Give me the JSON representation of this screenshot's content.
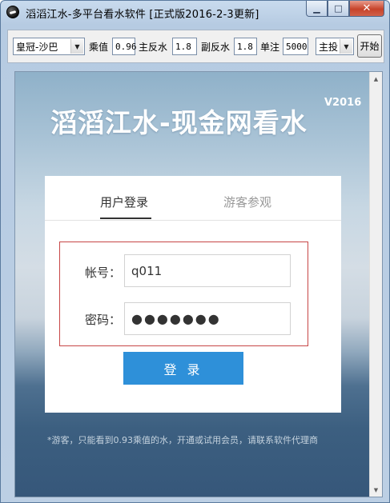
{
  "window": {
    "title": "滔滔江水-多平台看水软件  [正式版2016-2-3更新]",
    "controls": {
      "minimize": "▁",
      "maximize": "□",
      "close": "✕"
    }
  },
  "toolbar": {
    "site_select": "皇冠-沙巴",
    "odds_label": "乘值",
    "odds_value": "0.96",
    "main_rebate_label": "主反水",
    "main_rebate_value": "1.8",
    "sub_rebate_label": "副反水",
    "sub_rebate_value": "1.8",
    "single_bet_label": "单注",
    "single_bet_value": "5000",
    "mode_select": "主投",
    "start_label": "开始"
  },
  "banner": {
    "title": "滔滔江水-现金网看水",
    "version": "V2016"
  },
  "login": {
    "tabs": [
      "用户登录",
      "游客参观"
    ],
    "active_tab": "用户登录",
    "account_label": "帐号：",
    "account_value": "q011",
    "password_label": "密码：",
    "password_value": "●●●●●●●",
    "submit_label": "登 录"
  },
  "footnote": "*游客，只能看到0.93乘值的水，开通或试用会员，请联系软件代理商",
  "colors": {
    "accent": "#2e90d9",
    "form_border": "#c74646",
    "title_text": "#ffffff"
  }
}
